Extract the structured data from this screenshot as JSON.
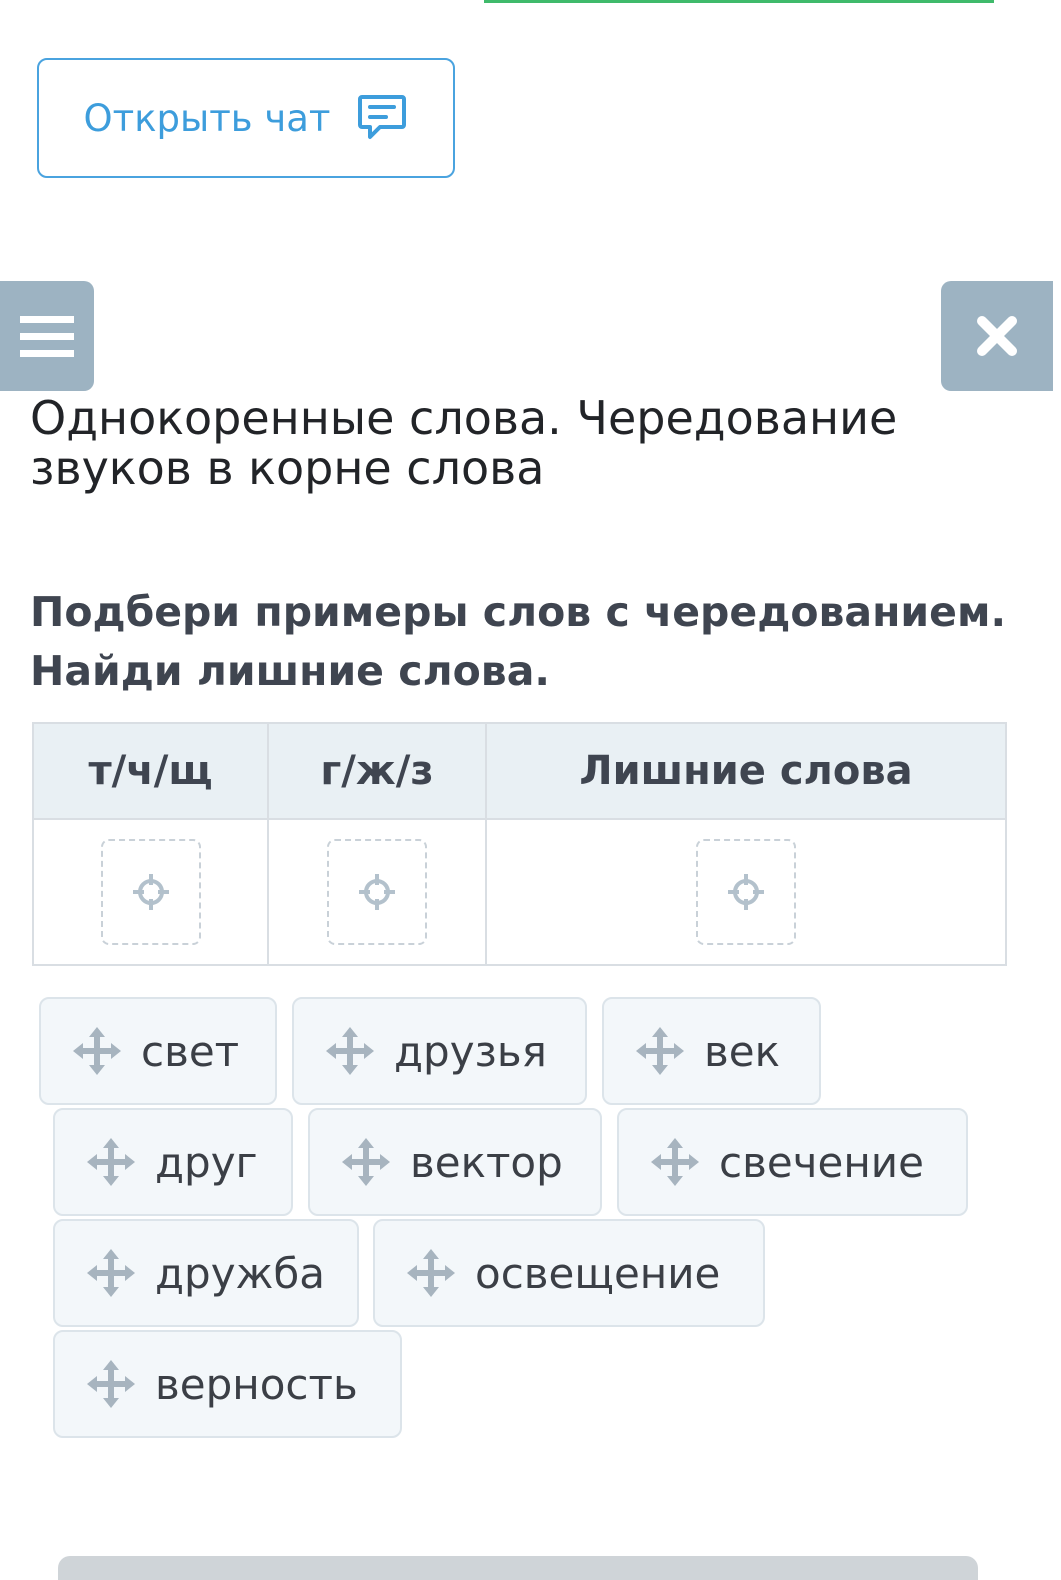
{
  "chat_button": {
    "label": "Открыть чат",
    "icon": "chat-icon"
  },
  "menu_button": {
    "icon": "hamburger-icon"
  },
  "close_button": {
    "icon": "close-icon"
  },
  "title": "Однокоренные слова. Чередование звуков в корне слова",
  "task": {
    "line1": "Подбери примеры слов с чередованием.",
    "line2": "Найди лишние слова."
  },
  "table": {
    "columns": [
      "т/ч/щ",
      "г/ж/з",
      "Лишние слова"
    ],
    "drop_icon": "target-icon"
  },
  "words": [
    "свет",
    "друзья",
    "век",
    "друг",
    "вектор",
    "свечение",
    "дружба",
    "освещение",
    "верность"
  ],
  "drag_icon": "move-icon",
  "colors": {
    "accent": "#3d9ddc",
    "panel_button": "#9db3c2",
    "header_bg": "#e9f0f4",
    "chip_bg": "#f3f7fa",
    "progress_line": "#3fba6b"
  }
}
